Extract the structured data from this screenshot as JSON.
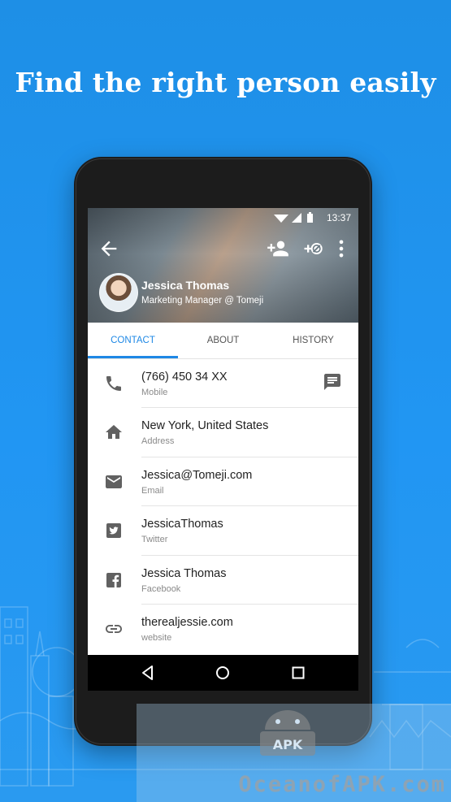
{
  "headline": "Find the right person easily",
  "status_bar": {
    "time": "13:37",
    "icons": [
      "wifi-icon",
      "signal-icon",
      "battery-icon"
    ]
  },
  "toolbar": {
    "icons": [
      "back-arrow-icon",
      "add-contact-icon",
      "block-contact-icon",
      "more-vert-icon"
    ]
  },
  "profile": {
    "name": "Jessica Thomas",
    "title": "Marketing Manager @ Tomeji"
  },
  "tabs": [
    {
      "label": "CONTACT",
      "active": true
    },
    {
      "label": "ABOUT",
      "active": false
    },
    {
      "label": "HISTORY",
      "active": false
    }
  ],
  "contact_items": [
    {
      "icon": "phone-icon",
      "value": "(766) 450 34 XX",
      "label": "Mobile",
      "action_icon": "message-icon"
    },
    {
      "icon": "home-icon",
      "value": "New York, United States",
      "label": "Address"
    },
    {
      "icon": "email-icon",
      "value": "Jessica@Tomeji.com",
      "label": "Email"
    },
    {
      "icon": "twitter-icon",
      "value": "JessicaThomas",
      "label": "Twitter"
    },
    {
      "icon": "facebook-icon",
      "value": "Jessica Thomas",
      "label": "Facebook"
    },
    {
      "icon": "link-icon",
      "value": "therealjessie.com",
      "label": "website"
    }
  ],
  "nav_bar": {
    "icons": [
      "back-triangle-icon",
      "home-circle-icon",
      "recents-square-icon"
    ]
  },
  "watermark": {
    "text": "OceanofAPK.com",
    "logo_text": "APK"
  },
  "colors": {
    "background": "#2196f3",
    "accent": "#1e88e5",
    "phone_body": "#1c1c1c"
  }
}
